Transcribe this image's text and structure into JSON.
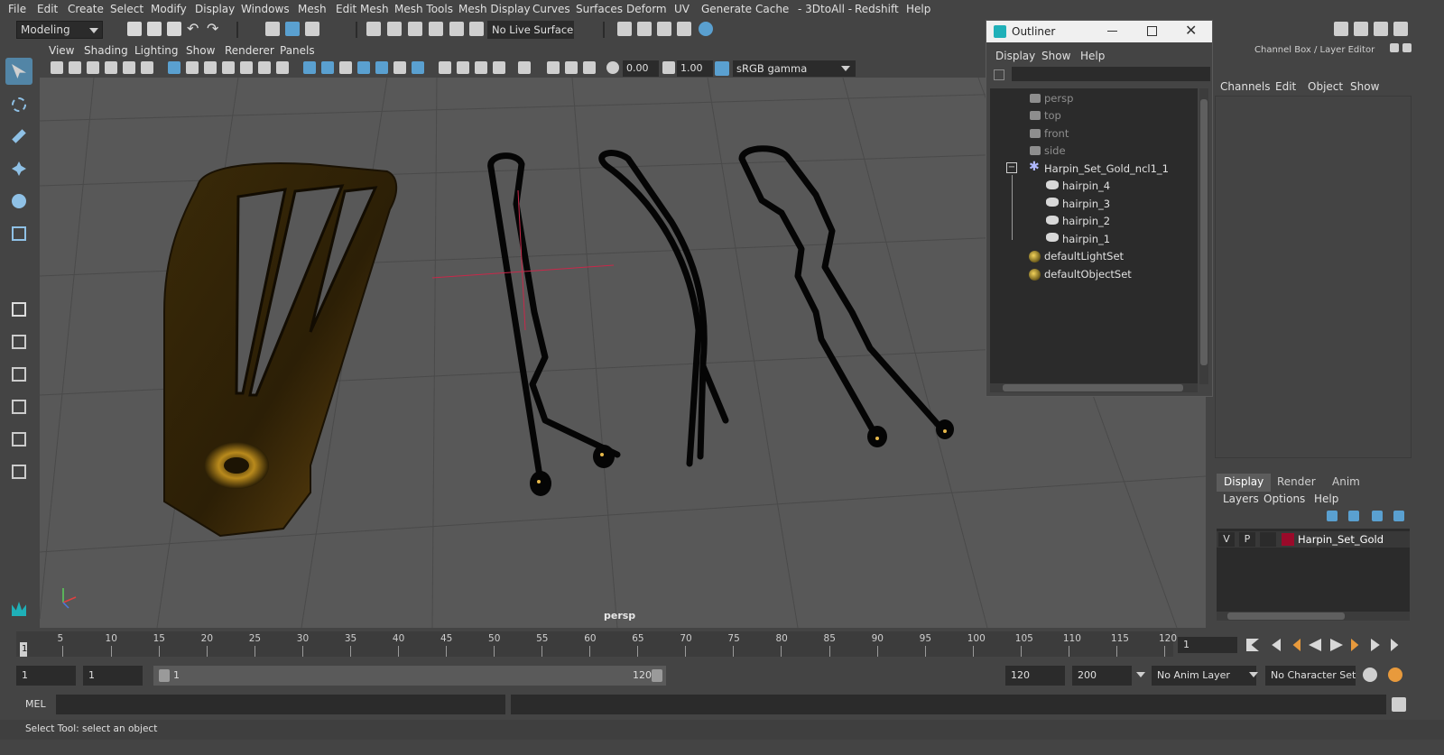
{
  "menubar": [
    "File",
    "Edit",
    "Create",
    "Select",
    "Modify",
    "Display",
    "Windows",
    "Mesh",
    "Edit Mesh",
    "Mesh Tools",
    "Mesh Display",
    "Curves",
    "Surfaces",
    "Deform",
    "UV",
    "Generate",
    "Cache",
    "- 3DtoAll -",
    "Redshift",
    "Help"
  ],
  "statusline": {
    "mode": "Modeling",
    "live_surface": "No Live Surface"
  },
  "viewport": {
    "menu": [
      "View",
      "Shading",
      "Lighting",
      "Show",
      "Renderer",
      "Panels"
    ],
    "exposure": "0.00",
    "gamma_value": "1.00",
    "color_space": "sRGB gamma",
    "camera_label": "persp"
  },
  "outliner": {
    "title": "Outliner",
    "menu": [
      "Display",
      "Show",
      "Help"
    ],
    "items": [
      {
        "label": "persp"
      },
      {
        "label": "top"
      },
      {
        "label": "front"
      },
      {
        "label": "side"
      },
      {
        "label": "Harpin_Set_Gold_ncl1_1"
      },
      {
        "label": "hairpin_4"
      },
      {
        "label": "hairpin_3"
      },
      {
        "label": "hairpin_2"
      },
      {
        "label": "hairpin_1"
      },
      {
        "label": "defaultLightSet"
      },
      {
        "label": "defaultObjectSet"
      }
    ]
  },
  "channelbox": {
    "header": "Channel Box / Layer Editor",
    "menu": [
      "Channels",
      "Edit",
      "Object",
      "Show"
    ],
    "tabs": [
      "Display",
      "Render",
      "Anim"
    ],
    "layer_menu": [
      "Layers",
      "Options",
      "Help"
    ],
    "layer": {
      "v": "V",
      "p": "P",
      "name": "Harpin_Set_Gold",
      "color": "#9a0a2a"
    }
  },
  "timeline": {
    "ticks": [
      "5",
      "10",
      "15",
      "20",
      "25",
      "30",
      "35",
      "40",
      "45",
      "50",
      "55",
      "60",
      "65",
      "70",
      "75",
      "80",
      "85",
      "90",
      "95",
      "100",
      "105",
      "110",
      "115",
      "120"
    ],
    "start_marker": "1",
    "current_frame": "1"
  },
  "range": {
    "start": "1",
    "playback_start": "1",
    "slider_start": "1",
    "slider_end": "120",
    "playback_end": "120",
    "end": "200",
    "anim_layer": "No Anim Layer",
    "character_set": "No Character Set"
  },
  "command": {
    "label": "MEL"
  },
  "help_line": "Select Tool: select an object"
}
